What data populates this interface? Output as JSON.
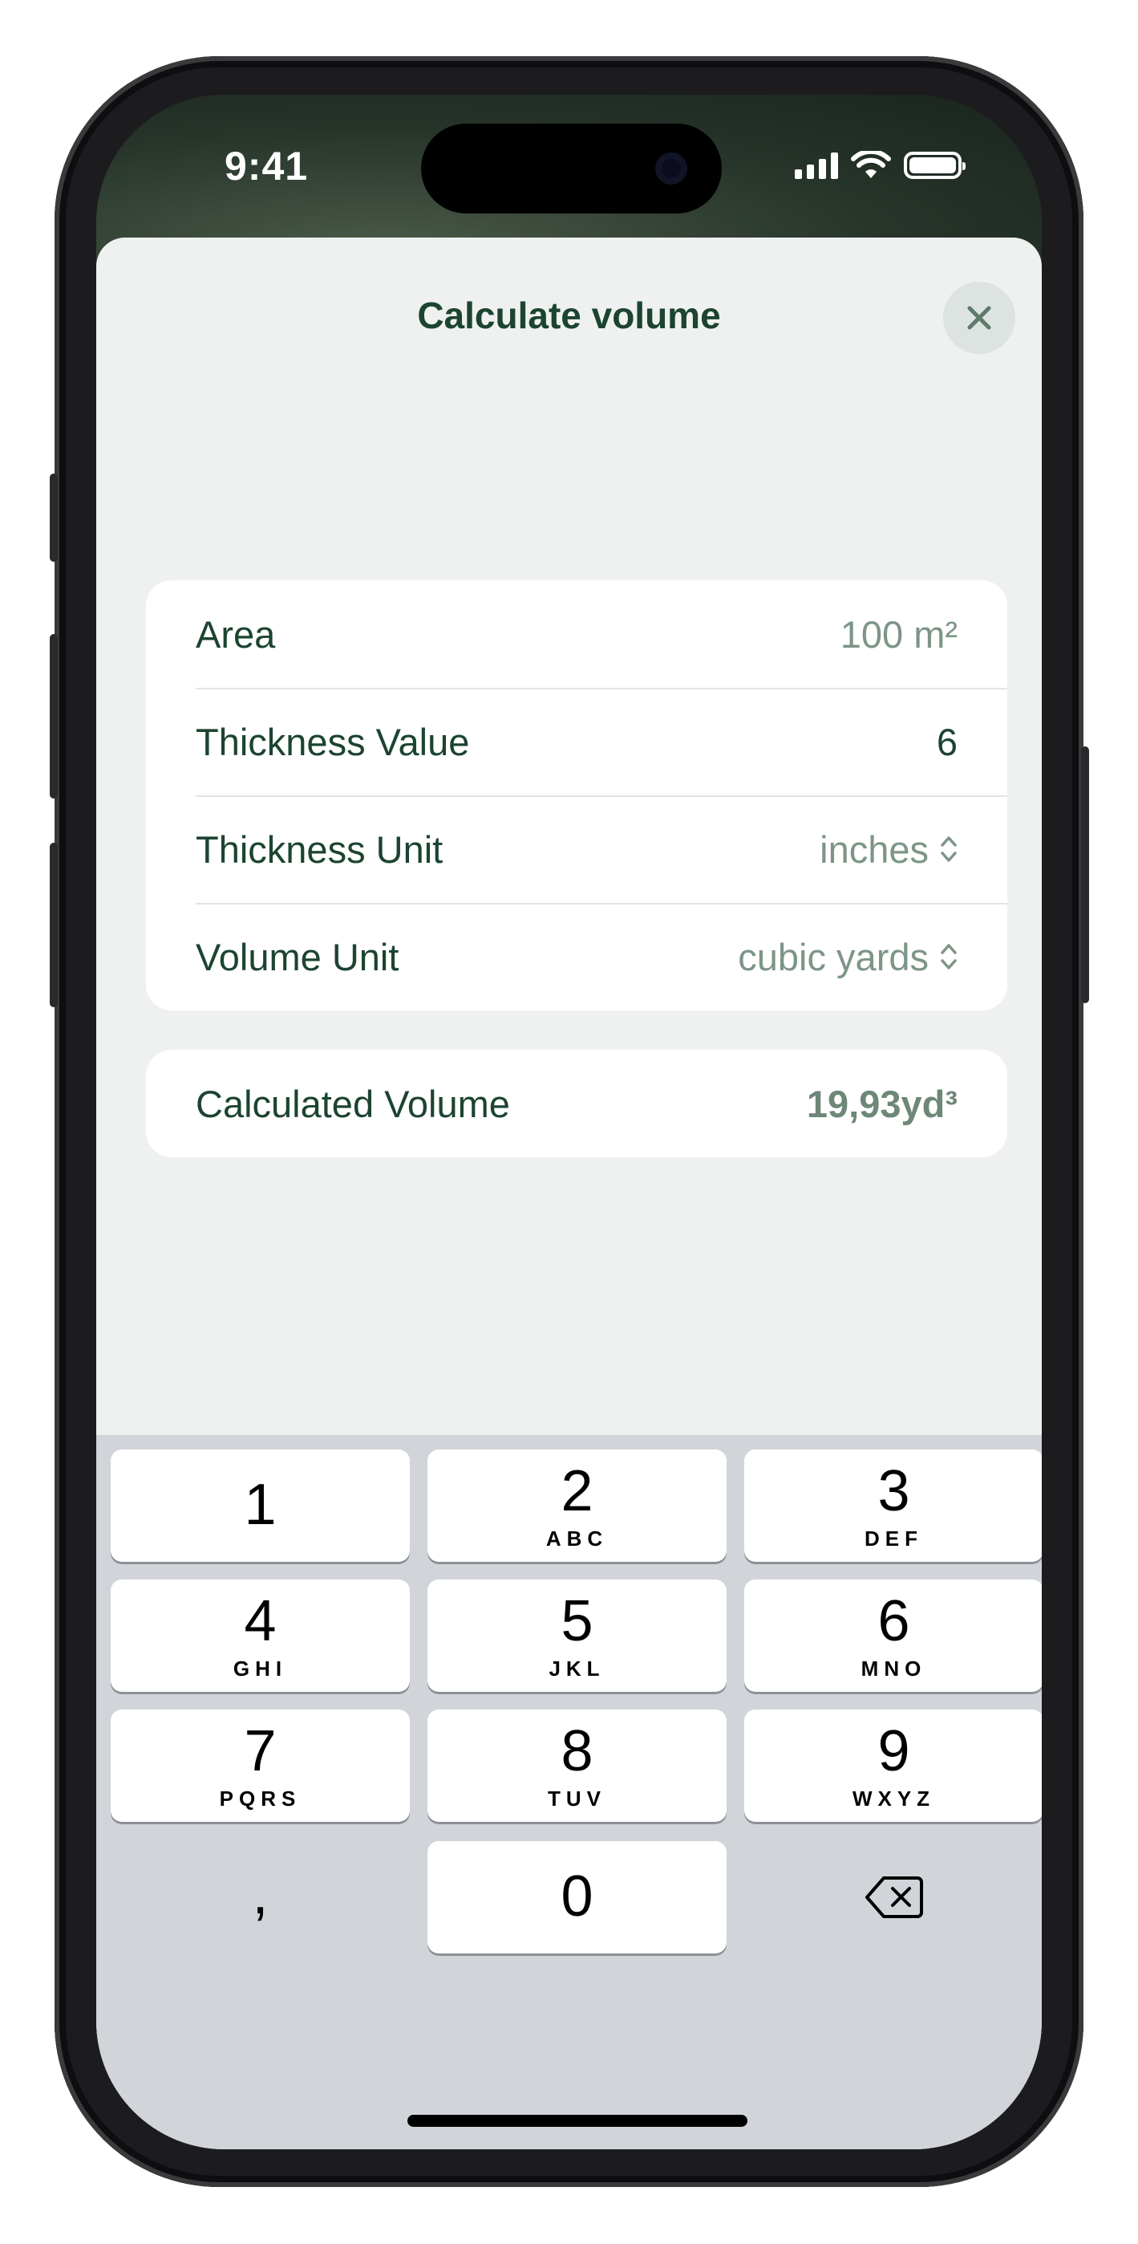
{
  "status_bar": {
    "time": "9:41"
  },
  "sheet": {
    "title": "Calculate volume",
    "close_icon": "close-icon"
  },
  "form": {
    "rows": [
      {
        "label": "Area",
        "value": "100 m²"
      },
      {
        "label": "Thickness Value",
        "value": "6"
      },
      {
        "label": "Thickness Unit",
        "value": "inches"
      },
      {
        "label": "Volume Unit",
        "value": "cubic yards"
      }
    ]
  },
  "result": {
    "label": "Calculated Volume",
    "value": "19,93yd³"
  },
  "keyboard": {
    "keys": [
      {
        "num": "1",
        "letters": ""
      },
      {
        "num": "2",
        "letters": "ABC"
      },
      {
        "num": "3",
        "letters": "DEF"
      },
      {
        "num": "4",
        "letters": "GHI"
      },
      {
        "num": "5",
        "letters": "JKL"
      },
      {
        "num": "6",
        "letters": "MNO"
      },
      {
        "num": "7",
        "letters": "PQRS"
      },
      {
        "num": "8",
        "letters": "TUV"
      },
      {
        "num": "9",
        "letters": "WXYZ"
      },
      {
        "num": "0",
        "letters": ""
      }
    ],
    "decimal_key": ",",
    "delete_icon": "backspace-icon"
  },
  "colors": {
    "accent": "#1c4430",
    "muted_value": "#7d9586",
    "sheet_bg": "#eff1f0",
    "keyboard_bg": "#d1d4d9"
  }
}
